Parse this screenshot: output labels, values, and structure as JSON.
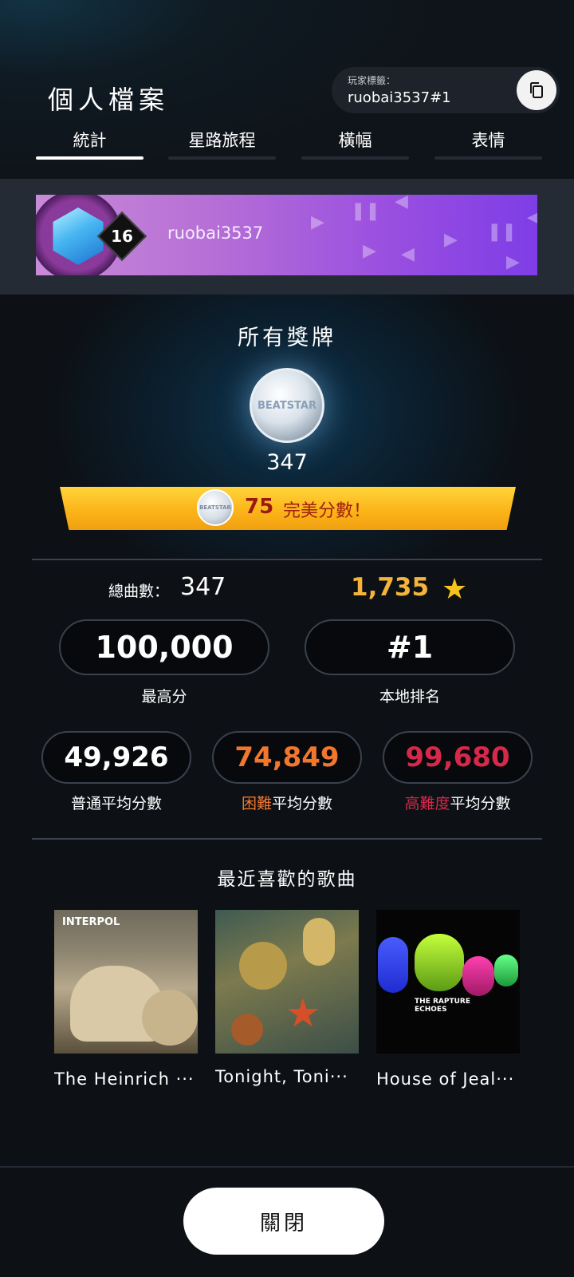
{
  "header": {
    "title": "個人檔案",
    "player_tag_label": "玩家標籤：",
    "player_tag_value": "ruobai3537#1"
  },
  "tabs": [
    {
      "label": "統計",
      "active": true
    },
    {
      "label": "星路旅程",
      "active": false
    },
    {
      "label": "橫幅",
      "active": false
    },
    {
      "label": "表情",
      "active": false
    }
  ],
  "banner": {
    "level": "16",
    "username": "ruobai3537"
  },
  "medals": {
    "title": "所有獎牌",
    "medal_logo": "BEATSTAR",
    "count": "347",
    "perfect_count": "75",
    "perfect_label": "完美分數！"
  },
  "stats": {
    "total_songs_label": "總曲數：",
    "total_songs_value": "347",
    "stars_value": "1,735",
    "top_score_value": "100,000",
    "top_score_label": "最高分",
    "local_rank_value": "#1",
    "local_rank_label": "本地排名",
    "normal_avg_value": "49,926",
    "normal_avg_label": "普通平均分數",
    "hard_avg_value": "74,849",
    "hard_avg_prefix": "困難",
    "hard_avg_suffix": "平均分數",
    "extreme_avg_value": "99,680",
    "extreme_avg_prefix": "高難度",
    "extreme_avg_suffix": "平均分數"
  },
  "recent_songs": {
    "title": "最近喜歡的歌曲",
    "items": [
      {
        "title": "The Heinrich ···",
        "cover_text": "INTERPOL"
      },
      {
        "title": "Tonight, Toni···",
        "cover_text": ""
      },
      {
        "title": "House of Jeal···",
        "cover_text": "THE RAPTURE ECHOES"
      }
    ]
  },
  "footer": {
    "close_label": "關閉"
  },
  "colors": {
    "background": "#0d1015",
    "accent_gold": "#f4b43b",
    "hard": "#f2772e",
    "extreme": "#d6294a"
  }
}
